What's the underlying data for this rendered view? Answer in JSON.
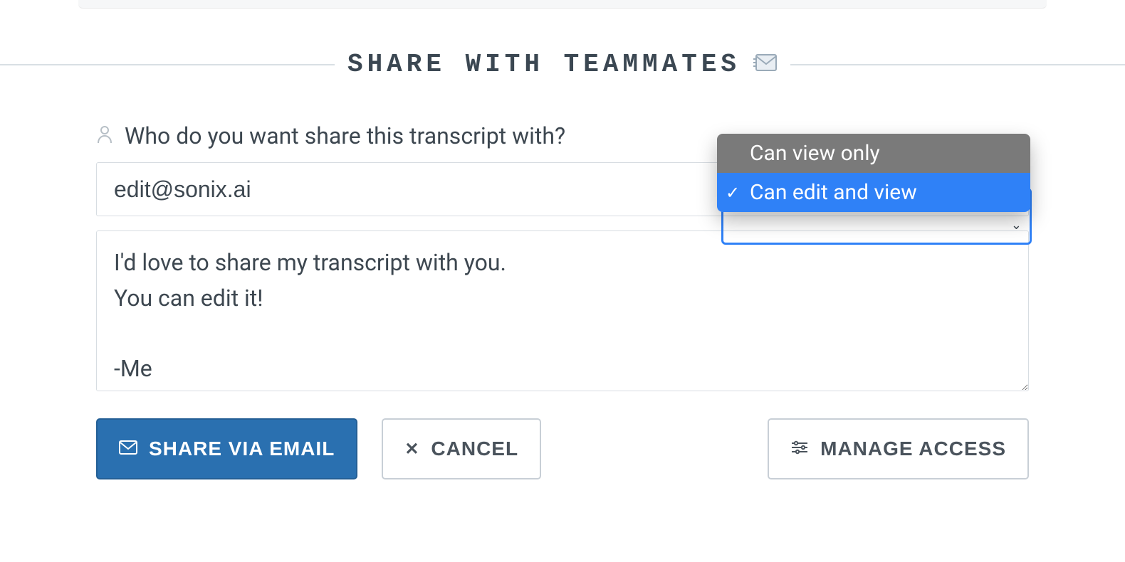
{
  "heading": {
    "title": "SHARE WITH TEAMMATES",
    "icon": "envelope-icon"
  },
  "form": {
    "label": "Who do you want share this transcript with?",
    "email_value": "edit@sonix.ai",
    "message_value": "I'd love to share my transcript with you.\nYou can edit it!\n\n-Me",
    "permission": {
      "options": [
        "Can view only",
        "Can edit and view"
      ],
      "selected_index": 1
    }
  },
  "buttons": {
    "share": "SHARE VIA EMAIL",
    "cancel": "CANCEL",
    "manage": "MANAGE ACCESS"
  },
  "colors": {
    "primary": "#2a70b0",
    "highlight": "#2f81f7",
    "text": "#3d4750",
    "border": "#d7dde2"
  }
}
